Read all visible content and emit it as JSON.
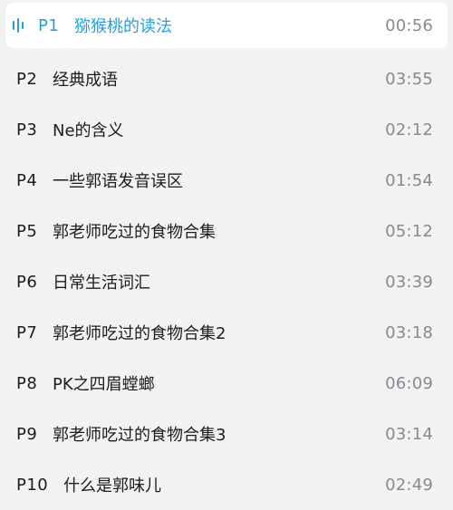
{
  "episodes": [
    {
      "part": "P1",
      "title": "猕猴桃的读法",
      "duration": "00:56"
    },
    {
      "part": "P2",
      "title": "经典成语",
      "duration": "03:55"
    },
    {
      "part": "P3",
      "title": "Ne的含义",
      "duration": "02:12"
    },
    {
      "part": "P4",
      "title": "一些郭语发音误区",
      "duration": "01:54"
    },
    {
      "part": "P5",
      "title": "郭老师吃过的食物合集",
      "duration": "05:12"
    },
    {
      "part": "P6",
      "title": "日常生活词汇",
      "duration": "03:39"
    },
    {
      "part": "P7",
      "title": "郭老师吃过的食物合集2",
      "duration": "03:18"
    },
    {
      "part": "P8",
      "title": "PK之四眉螳螂",
      "duration": "06:09"
    },
    {
      "part": "P9",
      "title": "郭老师吃过的食物合集3",
      "duration": "03:14"
    },
    {
      "part": "P10",
      "title": "什么是郭味儿",
      "duration": "02:49"
    }
  ],
  "active_index": 0,
  "colors": {
    "accent": "#20a0dc",
    "background": "#f2f2f4",
    "active_row_bg": "#ffffff",
    "text": "#1c1c1e",
    "duration": "#8a8a8e"
  },
  "icons": {
    "now_playing": "sound-wave-icon"
  }
}
